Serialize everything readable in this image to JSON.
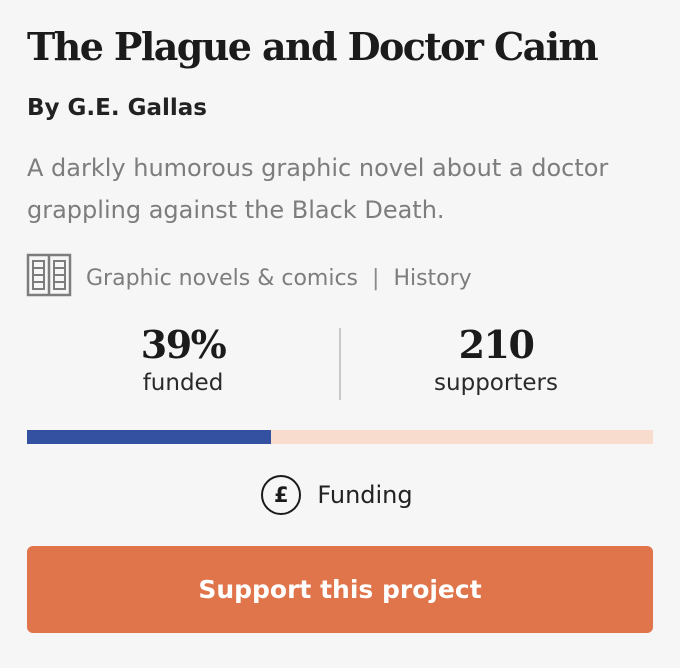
{
  "project": {
    "title": "The Plague and Doctor Caim",
    "author": "By G.E. Gallas",
    "description": "A darkly humorous graphic novel about a doctor grappling against the Black Death."
  },
  "categories": {
    "icon": "book-icon",
    "items": [
      "Graphic novels & comics",
      "History"
    ],
    "separator": "|"
  },
  "stats": {
    "funded_value": "39%",
    "funded_label": "funded",
    "supporters_value": "210",
    "supporters_label": "supporters"
  },
  "progress": {
    "percent": 39,
    "fill_color": "#3451a1",
    "track_color": "#f8dccd"
  },
  "funding": {
    "icon": "pound-icon",
    "icon_glyph": "£",
    "label": "Funding"
  },
  "cta": {
    "label": "Support this project",
    "color": "#e0744a"
  }
}
